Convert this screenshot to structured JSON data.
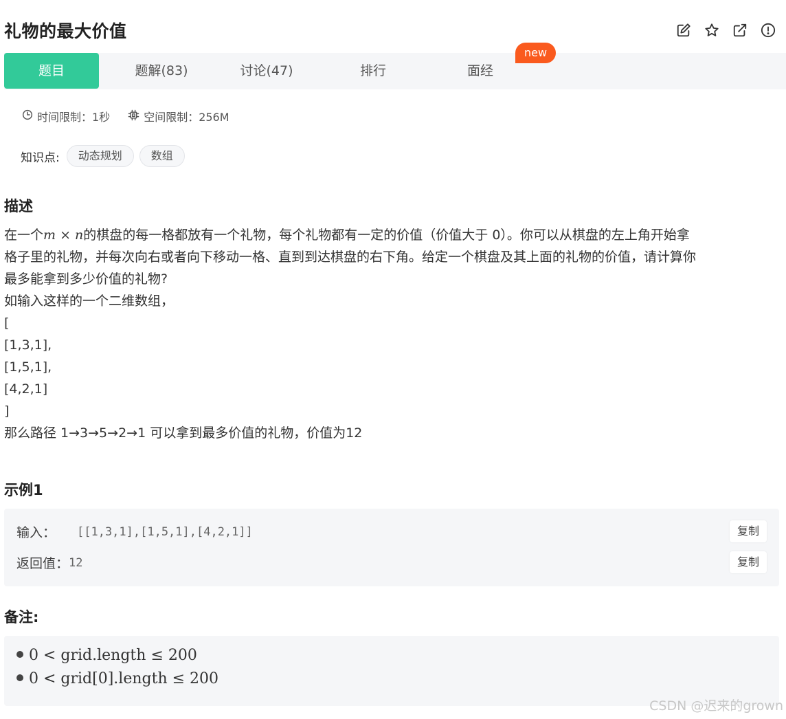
{
  "header": {
    "title": "礼物的最大价值",
    "tools": [
      "edit-icon",
      "star-icon",
      "external-link-icon",
      "info-icon"
    ]
  },
  "tabs": [
    {
      "label": "题目",
      "active": true
    },
    {
      "label": "题解(83)",
      "active": false
    },
    {
      "label": "讨论(47)",
      "active": false
    },
    {
      "label": "排行",
      "active": false
    },
    {
      "label": "面经",
      "active": false
    }
  ],
  "badge": {
    "label": "new",
    "color": "#fa5a1e"
  },
  "limits": {
    "time": "时间限制：1秒",
    "space": "空间限制：256M"
  },
  "knowledge": {
    "label": "知识点:",
    "tags": [
      "动态规划",
      "数组"
    ]
  },
  "description": {
    "title": "描述",
    "line1_pre": "在一个",
    "line1_math": "m × n",
    "line1_post": "的棋盘的每一格都放有一个礼物，每个礼物都有一定的价值（价值大于 0）。你可以从棋盘的左上角开始拿",
    "line2": "格子里的礼物，并每次向右或者向下移动一格、直到到达棋盘的右下角。给定一个棋盘及其上面的礼物的价值，请计算你",
    "line3": "最多能拿到多少价值的礼物?",
    "line4": "如输入这样的一个二维数组，",
    "line5": "[",
    "line6": "[1,3,1],",
    "line7": "[1,5,1],",
    "line8": "[4,2,1]",
    "line9": "]",
    "line10": "那么路径 1→3→5→2→1 可以拿到最多价值的礼物，价值为12"
  },
  "example": {
    "title": "示例1",
    "input_label": "输入：",
    "input_value": "[[1,3,1],[1,5,1],[4,2,1]]",
    "output_label": "返回值：",
    "output_value": "12",
    "copy_label": "复制"
  },
  "notes": {
    "title": "备注:",
    "items": [
      "0 < grid.length ≤ 200",
      "0 < grid[0].length ≤ 200"
    ]
  },
  "watermark": "CSDN @迟来的grown",
  "colors": {
    "accent": "#32ca99",
    "badge": "#fa5a1e",
    "panel": "#f5f6f8"
  }
}
